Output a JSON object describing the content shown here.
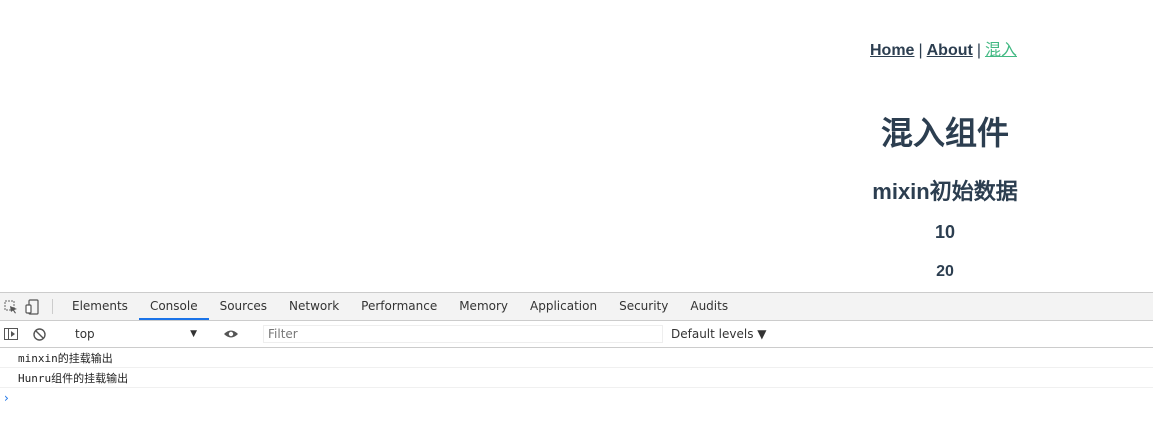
{
  "nav": {
    "home": "Home",
    "about": "About",
    "mixin": "混入",
    "separator": "|",
    "active_color": "#42b983"
  },
  "page": {
    "title": "混入组件",
    "subtitle": "mixin初始数据",
    "value1": "10",
    "value2": "20"
  },
  "devtools": {
    "tools": [
      "inspect-element-icon",
      "device-toolbar-icon"
    ],
    "tabs": [
      "Elements",
      "Console",
      "Sources",
      "Network",
      "Performance",
      "Memory",
      "Application",
      "Security",
      "Audits"
    ],
    "selected_tab": "Console",
    "console_bar": {
      "context": "top",
      "filter_placeholder": "Filter",
      "levels": "Default levels ▼"
    },
    "messages": [
      "minxin的挂载输出",
      "Hunru组件的挂载输出"
    ],
    "prompt": "›",
    "accent": "#1a73e8"
  }
}
